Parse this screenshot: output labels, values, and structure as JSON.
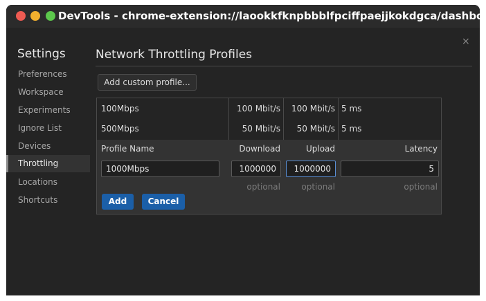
{
  "window": {
    "title": "DevTools - chrome-extension://laookkfknpbbblfpciffpaejjkokdgca/dashboard.html"
  },
  "icons": {
    "close": "close-icon"
  },
  "close_glyph": "×",
  "sidebar": {
    "title": "Settings",
    "items": [
      {
        "label": "Preferences",
        "active": false
      },
      {
        "label": "Workspace",
        "active": false
      },
      {
        "label": "Experiments",
        "active": false
      },
      {
        "label": "Ignore List",
        "active": false
      },
      {
        "label": "Devices",
        "active": false
      },
      {
        "label": "Throttling",
        "active": true
      },
      {
        "label": "Locations",
        "active": false
      },
      {
        "label": "Shortcuts",
        "active": false
      }
    ]
  },
  "main": {
    "title": "Network Throttling Profiles",
    "add_custom_label": "Add custom profile...",
    "profiles": [
      {
        "name": "100Mbps",
        "download": "100 Mbit/s",
        "upload": "100 Mbit/s",
        "latency": "5 ms"
      },
      {
        "name": "500Mbps",
        "download": "50 Mbit/s",
        "upload": "50 Mbit/s",
        "latency": "5 ms"
      }
    ],
    "editor": {
      "headers": {
        "name": "Profile Name",
        "download": "Download",
        "upload": "Upload",
        "latency": "Latency"
      },
      "values": {
        "name": "1000Mbps",
        "download": "1000000",
        "upload": "1000000",
        "latency": "5"
      },
      "optional_label": "optional",
      "add_label": "Add",
      "cancel_label": "Cancel"
    }
  },
  "colors": {
    "accent": "#1b5fa8",
    "focus_border": "#5a8fd6",
    "background": "#242424"
  }
}
